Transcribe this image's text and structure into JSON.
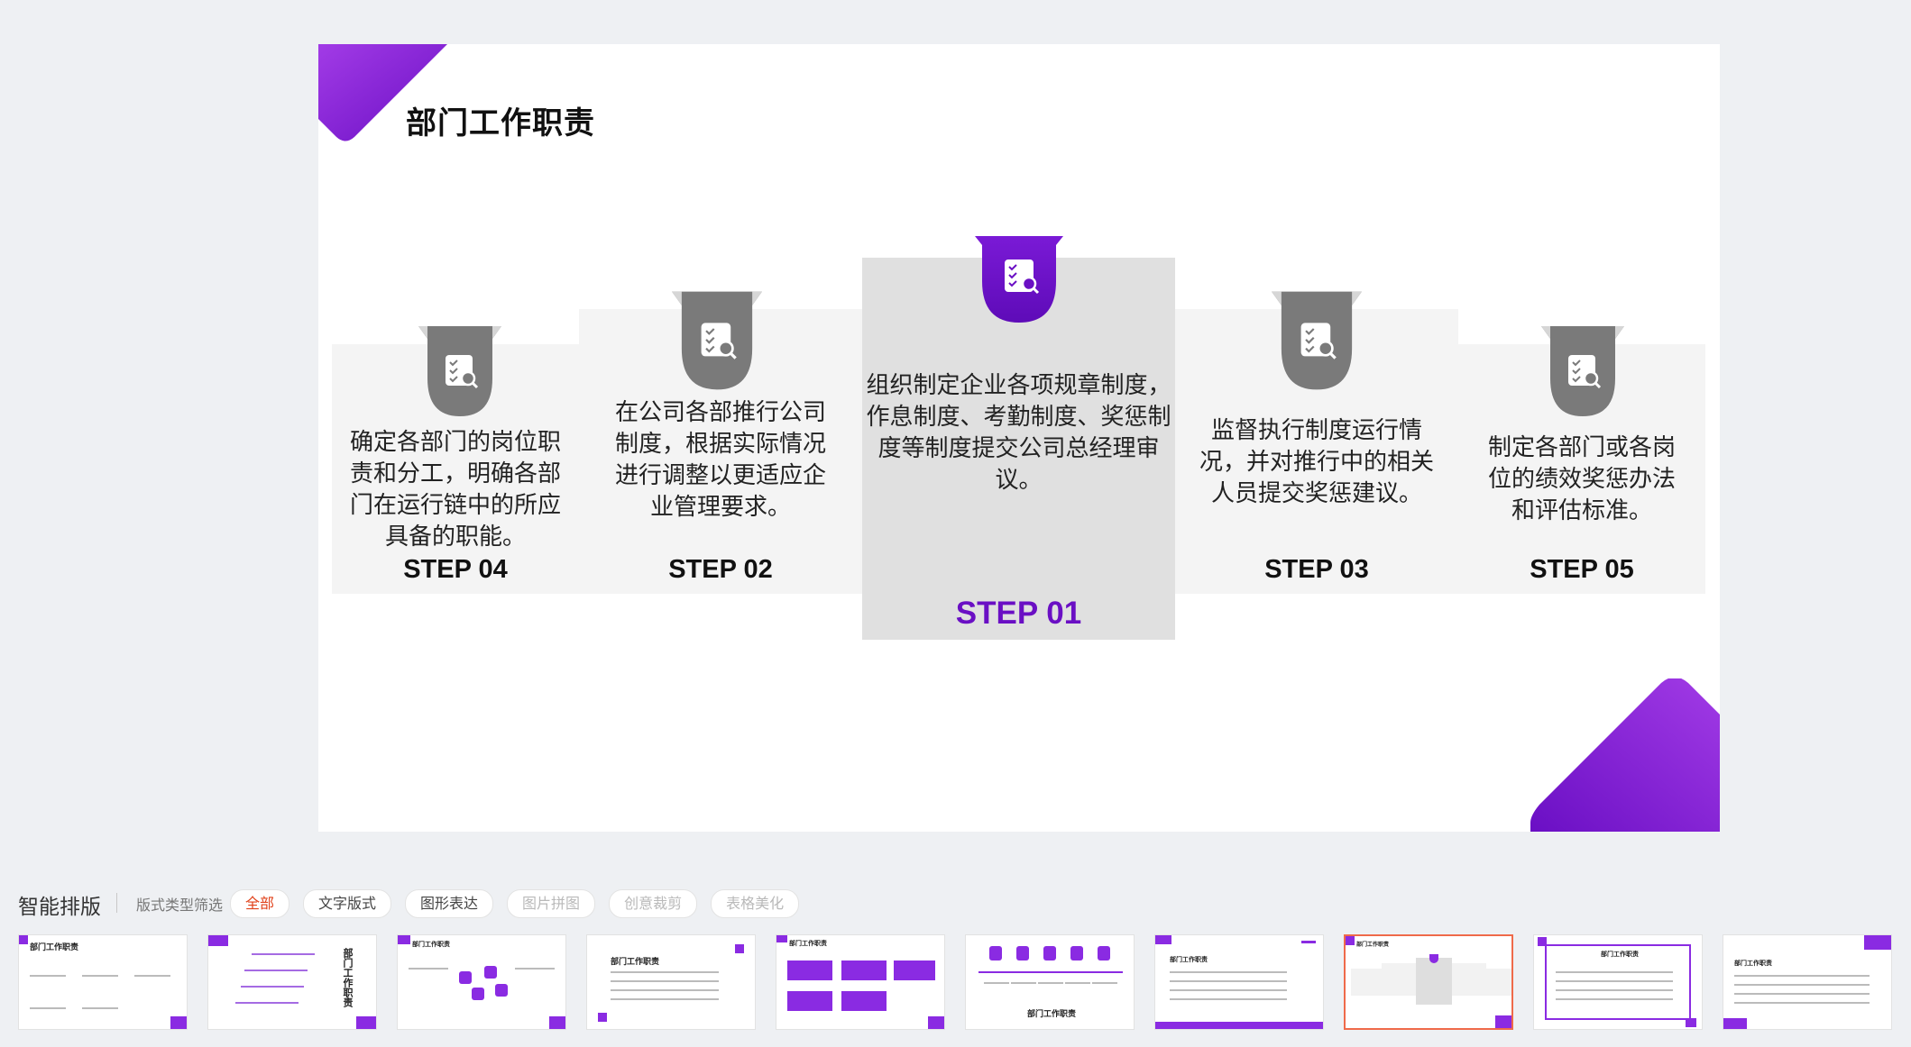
{
  "slide": {
    "title": "部门工作职责",
    "colors": {
      "accent": "#6a0fc4",
      "accent_light": "#9b3be0",
      "badge_gray": "#7a7a7a"
    },
    "cards": [
      {
        "step": "STEP 04",
        "text": "确定各部门的岗位职责和分工，明确各部门在运行链中的所应具备的职能。",
        "icon": "checklist-search-icon"
      },
      {
        "step": "STEP 02",
        "text": "在公司各部推行公司制度，根据实际情况进行调整以更适应企业管理要求。",
        "icon": "checklist-search-icon"
      },
      {
        "step": "STEP 01",
        "text": "组织制定企业各项规章制度，作息制度、考勤制度、奖惩制度等制度提交公司总经理审议。",
        "icon": "checklist-search-icon"
      },
      {
        "step": "STEP 03",
        "text": "监督执行制度运行情况，并对推行中的相关人员提交奖惩建议。",
        "icon": "checklist-search-icon"
      },
      {
        "step": "STEP 05",
        "text": "制定各部门或各岗位的绩效奖惩办法和评估标准。",
        "icon": "checklist-search-icon"
      }
    ]
  },
  "panel": {
    "title": "智能排版",
    "filter_label": "版式类型筛选",
    "chips": [
      {
        "label": "全部",
        "state": "active"
      },
      {
        "label": "文字版式",
        "state": "normal"
      },
      {
        "label": "图形表达",
        "state": "normal"
      },
      {
        "label": "图片拼图",
        "state": "disabled"
      },
      {
        "label": "创意裁剪",
        "state": "disabled"
      },
      {
        "label": "表格美化",
        "state": "disabled"
      }
    ],
    "thumbnails": [
      {
        "title": "部门工作职责"
      },
      {
        "title": "部门工作职责"
      },
      {
        "title": "部门工作职责"
      },
      {
        "title": "部门工作职责"
      },
      {
        "title": "部门工作职责"
      },
      {
        "title": "部门工作职责"
      },
      {
        "title": "部门工作职责"
      },
      {
        "title": "部门工作职责"
      },
      {
        "title": "部门工作职责"
      },
      {
        "title": "部门工作职责"
      }
    ],
    "selected_thumbnail": 8
  }
}
